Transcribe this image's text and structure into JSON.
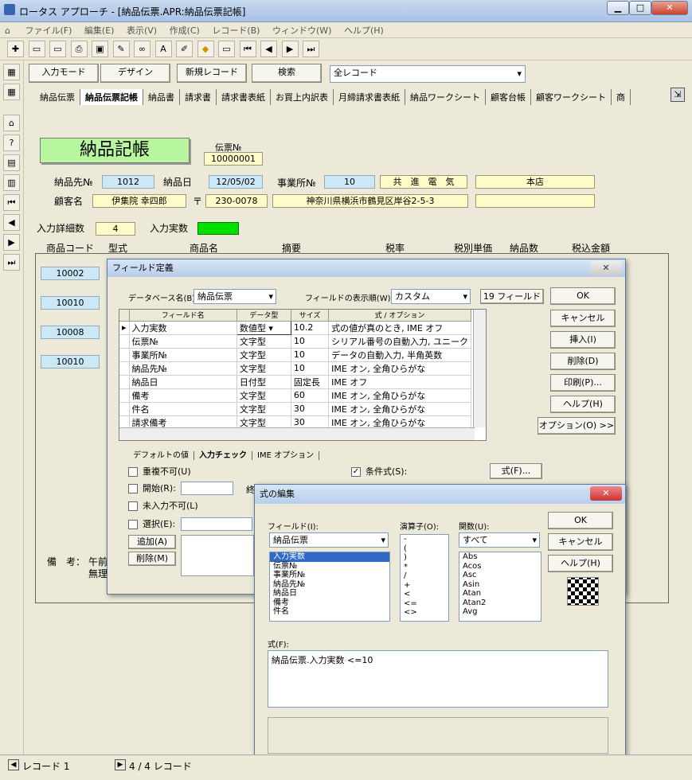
{
  "window": {
    "title": "ロータス アプローチ - [納品伝票.APR:納品伝票記帳]",
    "min": "▁",
    "max": "□",
    "close": "✕"
  },
  "menu": [
    "ファイル(F)",
    "編集(E)",
    "表示(V)",
    "作成(C)",
    "レコード(B)",
    "ウィンドウ(W)",
    "ヘルプ(H)"
  ],
  "actionbar": {
    "input_mode": "入力モード",
    "design": "デザイン",
    "new_record": "新規レコード",
    "search": "検索",
    "record_filter": "全レコード"
  },
  "tabs": [
    "納品伝票",
    "納品伝票記帳",
    "納品書",
    "請求書",
    "請求書表紙",
    "お買上内訳表",
    "月締請求書表紙",
    "納品ワークシート",
    "顧客台帳",
    "顧客ワークシート",
    "商"
  ],
  "form": {
    "title": "納品記帳",
    "voucher_label": "伝票№",
    "voucher_value": "10000001",
    "dest_label": "納品先№",
    "dest_value": "1012",
    "date_label": "納品日",
    "date_value": "12/05/02",
    "office_label": "事業所№",
    "office_value": "10",
    "office_name": "共　進　電　気",
    "branch": "本店",
    "customer_label": "顧客名",
    "customer_value": "伊集院 幸四郎",
    "postal_mark": "〒",
    "postal": "230-0078",
    "address": "神奈川県横浜市鶴見区岸谷2-5-3",
    "detail_count_label": "入力詳細数",
    "detail_count": "4",
    "actual_count_label": "入力実数",
    "columns": [
      "商品コード",
      "型式",
      "商品名",
      "摘要",
      "税率",
      "税別単価",
      "納品数",
      "税込金額"
    ],
    "rows": [
      "10002",
      "10010",
      "10008",
      "10010"
    ],
    "note_label": "備　考：",
    "note_text1": "午前",
    "note_text2": "無理"
  },
  "field_dialog": {
    "title": "フィールド定義",
    "close": "✕",
    "db_label": "データベース名(B):",
    "db_value": "納品伝票",
    "order_label": "フィールドの表示順(W):",
    "order_value": "カスタム",
    "field_count": "19 フィールド",
    "headers": [
      "フィールド名",
      "データ型",
      "サイズ",
      "式 / オプション"
    ],
    "rows": [
      {
        "name": "入力実数",
        "type": "数値型",
        "size": "10.2",
        "opt": "式の値が真のとき, IME オフ"
      },
      {
        "name": "伝票№",
        "type": "文字型",
        "size": "10",
        "opt": "シリアル番号の自動入力, ユニーク"
      },
      {
        "name": "事業所№",
        "type": "文字型",
        "size": "10",
        "opt": "データの自動入力, 半角英数"
      },
      {
        "name": "納品先№",
        "type": "文字型",
        "size": "10",
        "opt": "IME オン, 全角ひらがな"
      },
      {
        "name": "納品日",
        "type": "日付型",
        "size": "固定長",
        "opt": "IME オフ"
      },
      {
        "name": "備考",
        "type": "文字型",
        "size": "60",
        "opt": "IME オン, 全角ひらがな"
      },
      {
        "name": "件名",
        "type": "文字型",
        "size": "30",
        "opt": "IME オン, 全角ひらがな"
      },
      {
        "name": "請求備考",
        "type": "文字型",
        "size": "30",
        "opt": "IME オン, 全角ひらがな"
      }
    ],
    "buttons": [
      "OK",
      "キャンセル",
      "挿入(I)",
      "削除(D)",
      "印刷(P)...",
      "ヘルプ(H)",
      "オプション(O) >>"
    ],
    "subtabs": [
      "デフォルトの値",
      "入力チェック",
      "IME オプション"
    ],
    "checks": [
      "重複不可(U)",
      "開始(R):",
      "未入力不可(L)",
      "選択(E):"
    ],
    "range_end": "終",
    "cond_label": "条件式(S):",
    "formula_btn": "式(F)...",
    "add_btn": "追加(A)",
    "del_btn": "削除(M)"
  },
  "formula_dialog": {
    "title": "式の編集",
    "close": "✕",
    "field_label": "フィールド(I):",
    "field_select": "納品伝票",
    "fields": [
      "入力実数",
      "伝票№",
      "事業所№",
      "納品先№",
      "納品日",
      "備考",
      "件名"
    ],
    "ops_label": "演算子(O):",
    "ops": [
      "-",
      "(",
      ")",
      "*",
      "/",
      "+",
      "<",
      "<=",
      "<>"
    ],
    "func_label": "関数(U):",
    "func_select": "すべて",
    "funcs": [
      "Abs",
      "Acos",
      "Asc",
      "Asin",
      "Atan",
      "Atan2",
      "Avg"
    ],
    "buttons": [
      "OK",
      "キャンセル",
      "ヘルプ(H)"
    ],
    "formula_label": "式(F):",
    "formula": "納品伝票.入力実数 <=10"
  },
  "statusbar": {
    "record_label": "レコード 1",
    "count": "4 / 4 レコード"
  }
}
